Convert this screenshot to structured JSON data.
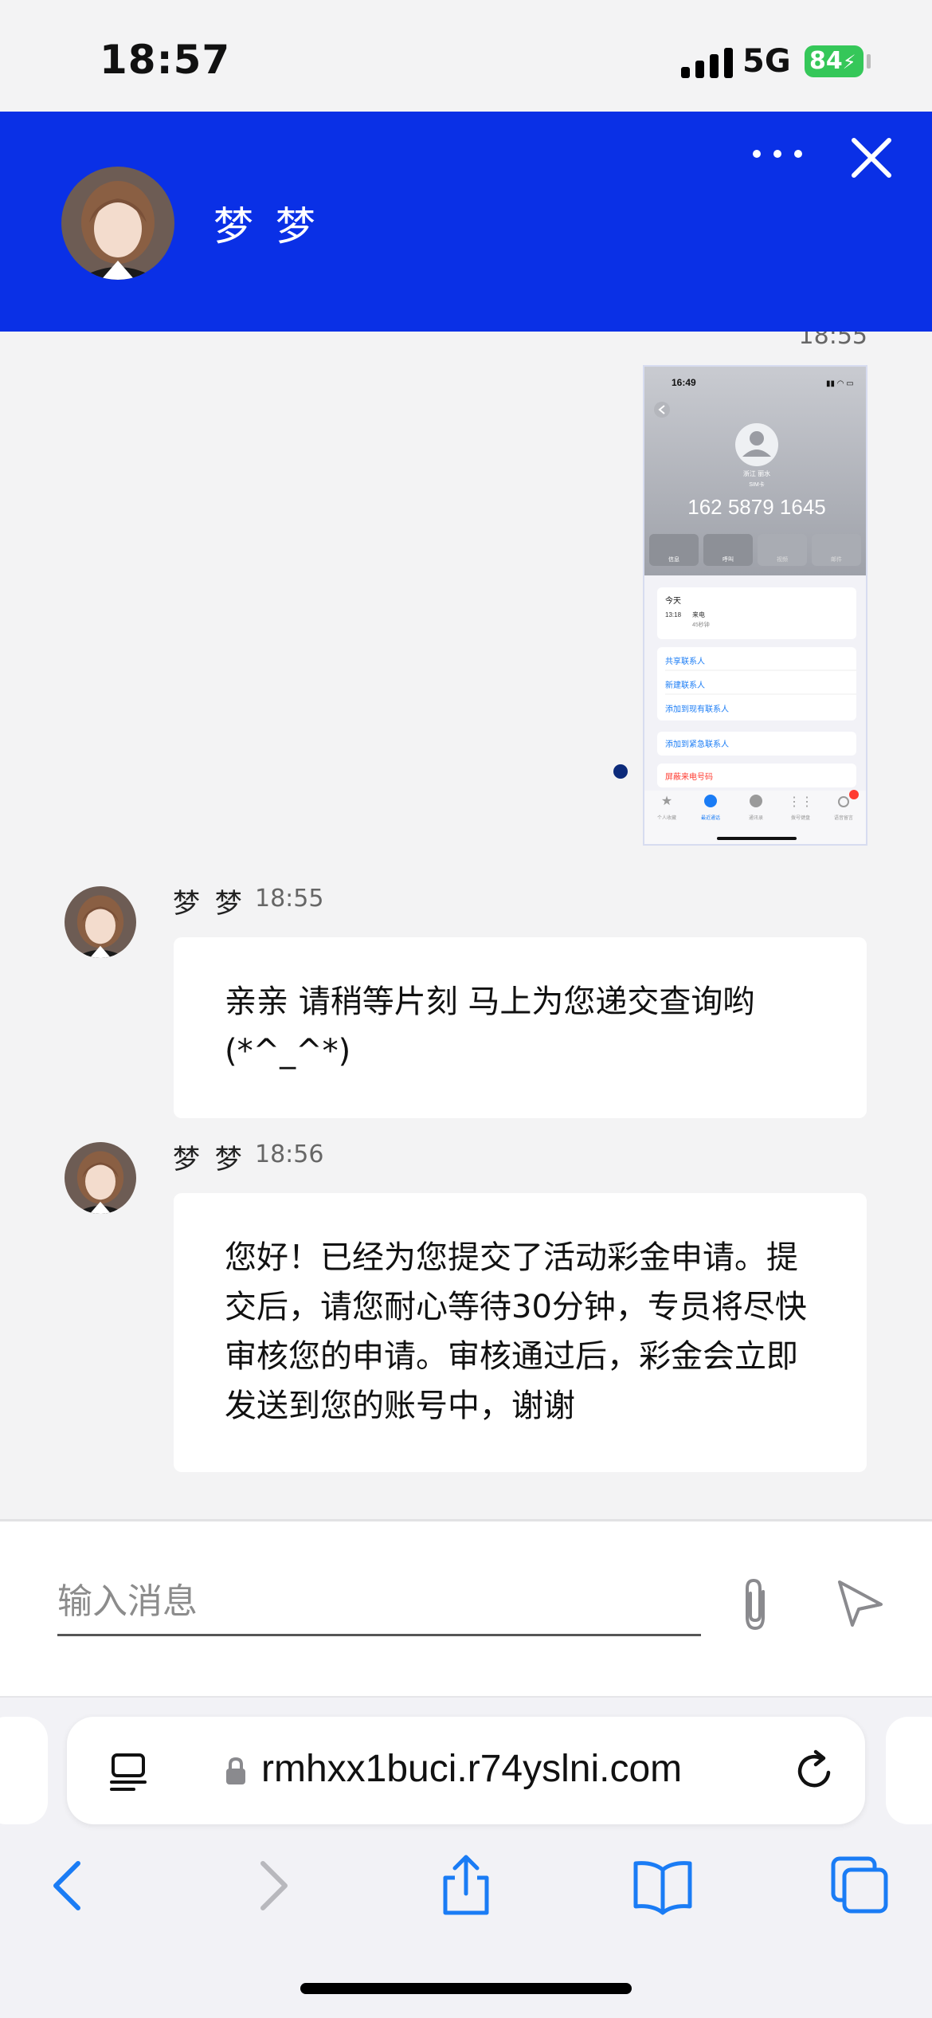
{
  "status_bar": {
    "time": "18:57",
    "network": "5G",
    "battery": "84"
  },
  "header": {
    "contact_name": "梦 梦"
  },
  "messages": {
    "image_timestamp": "18:55",
    "screenshot": {
      "time": "16:49",
      "location": "浙江 丽水",
      "sim": "SIM卡",
      "phone": "162 5879 1645",
      "actions": [
        "信息",
        "呼叫",
        "视频",
        "邮件"
      ],
      "today": "今天",
      "call_time": "13:18",
      "call_type": "来电",
      "call_duration": "45秒钟",
      "links": [
        "共享联系人",
        "新建联系人",
        "添加到现有联系人"
      ],
      "emergency": "添加到紧急联系人",
      "block": "屏蔽来电号码",
      "tabs": [
        "个人收藏",
        "最近通话",
        "通讯录",
        "拨号键盘",
        "语音留言"
      ]
    },
    "items": [
      {
        "name": "梦 梦",
        "time": "18:55",
        "text": "亲亲 请稍等片刻 马上为您递交查询哟(*^_^*)"
      },
      {
        "name": "梦 梦",
        "time": "18:56",
        "text": "您好！已经为您提交了活动彩金申请。提交后，请您耐心等待30分钟，专员将尽快审核您的申请。审核通过后，彩金会立即发送到您的账号中，谢谢"
      }
    ]
  },
  "composer": {
    "placeholder": "输入消息"
  },
  "browser": {
    "url": "rmhxx1buci.r74yslni.com"
  },
  "colors": {
    "header": "#0a30e6",
    "accent": "#1a7cf5",
    "battery": "#35c759"
  }
}
